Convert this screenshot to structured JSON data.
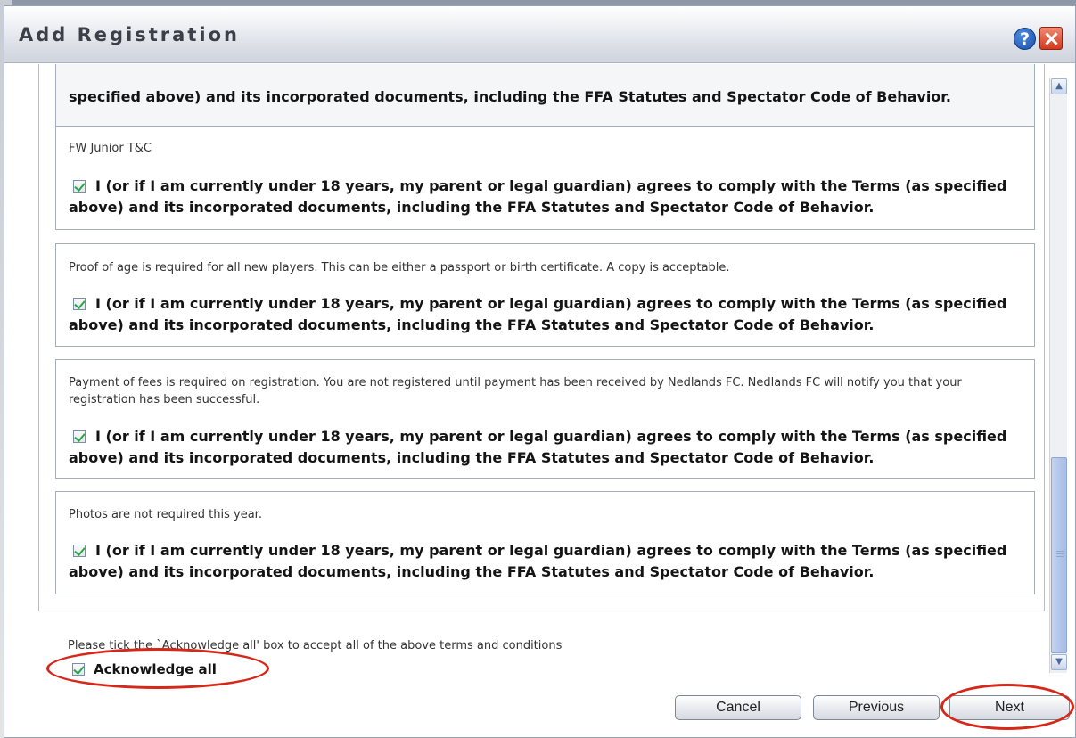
{
  "dialog": {
    "title": "Add Registration"
  },
  "agreement_text": "I (or if I am currently under 18 years, my parent or legal guardian) agrees to comply with the Terms (as specified above) and its incorporated documents, including the FFA Statutes and Spectator Code of Behavior.",
  "partial_top": {
    "text": "specified above) and its incorporated documents, including the FFA Statutes and Spectator Code of Behavior."
  },
  "sections": [
    {
      "heading": "FW Junior T&C",
      "checked": true
    },
    {
      "heading": "Proof of age is required for all new players. This can be either a passport or birth certificate. A copy is acceptable.",
      "checked": true
    },
    {
      "heading": "Payment of fees is required on registration. You are not registered until payment has been received by Nedlands FC. Nedlands FC will notify you that your registration has been successful.",
      "checked": true
    },
    {
      "heading": "Photos are not required this year.",
      "checked": true
    }
  ],
  "acknowledge": {
    "instructions": "Please tick the `Acknowledge all' box to accept all of the above terms and conditions",
    "label": "Acknowledge all",
    "checked": true
  },
  "buttons": {
    "cancel": "Cancel",
    "previous": "Previous",
    "next": "Next"
  },
  "colors": {
    "annotation_circle": "#d6281a",
    "checkmark": "#2aa64a"
  }
}
